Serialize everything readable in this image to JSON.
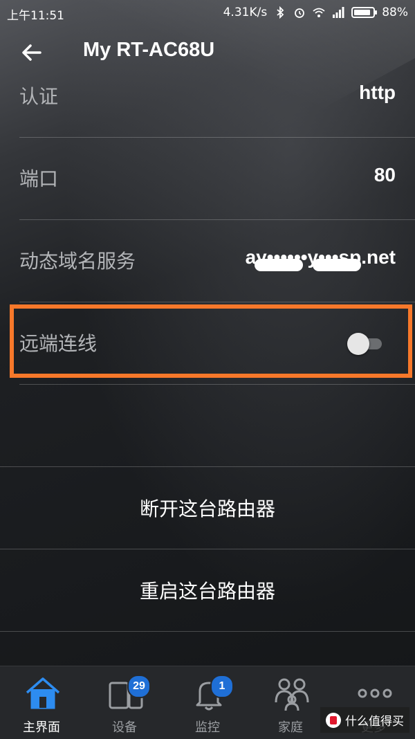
{
  "status_bar": {
    "time": "上午11:51",
    "net_speed": "4.31K/s",
    "battery": "88%"
  },
  "app_bar": {
    "title": "My RT-AC68U"
  },
  "settings": [
    {
      "label": "认证",
      "value": "http"
    },
    {
      "label": "端口",
      "value": "80"
    },
    {
      "label": "动态域名服务",
      "value": "ay••••••y•••sp.net"
    },
    {
      "label": "远端连线",
      "toggle": false
    }
  ],
  "actions": [
    {
      "label": "断开这台路由器"
    },
    {
      "label": "重启这台路由器"
    }
  ],
  "bottom_nav": [
    {
      "label": "主界面",
      "icon": "home-icon",
      "active": true
    },
    {
      "label": "设备",
      "icon": "devices-icon",
      "badge": "29"
    },
    {
      "label": "监控",
      "icon": "bell-icon",
      "badge": "1"
    },
    {
      "label": "家庭",
      "icon": "family-icon"
    },
    {
      "label": "更多",
      "icon": "more-icon"
    }
  ],
  "watermark": {
    "text": "什么值得买"
  },
  "colors": {
    "highlight": "#f7782a",
    "active_blue": "#1f6fd6"
  }
}
